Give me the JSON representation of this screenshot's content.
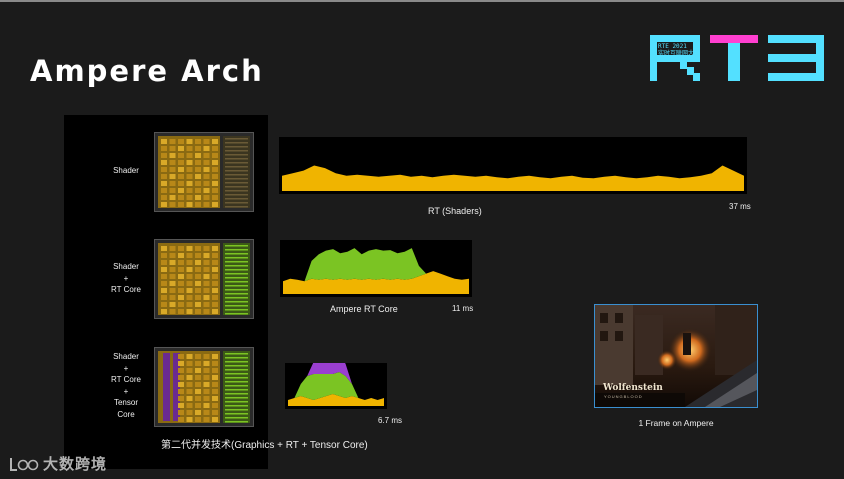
{
  "slide": {
    "title": "Ampere Arch",
    "logo": {
      "letters": "RTE",
      "tag_line1": "RTE 2021",
      "tag_line2": "实时互联网大会"
    }
  },
  "rows": [
    {
      "label_lines": [
        "Shader"
      ],
      "chart_caption": "RT (Shaders)",
      "time": "37 ms"
    },
    {
      "label_lines": [
        "Shader",
        "+",
        "RT Core"
      ],
      "chart_caption": "Ampere RT Core",
      "time": "11 ms"
    },
    {
      "label_lines": [
        "Shader",
        "+",
        "RT Core",
        "+",
        "Tensor",
        "Core"
      ],
      "chart_caption": "",
      "time": "6.7 ms"
    }
  ],
  "bottom_caption": "第二代并发技术(Graphics + RT + Tensor Core)",
  "frame": {
    "caption": "1 Frame on Ampere",
    "game_logo": "Wolfenstein",
    "game_sub": "YOUNGBLOOD"
  },
  "watermark": {
    "text": "大数跨境"
  },
  "colors": {
    "shader": "#f0b400",
    "rt_core": "#7bc423",
    "tensor": "#9a3fd0",
    "logo": "#53e0ff",
    "logo_accent": "#ff3fd0",
    "frame_border": "#3a8fd0"
  },
  "chart_data": [
    {
      "type": "area",
      "title": "RT (Shaders)",
      "time_ms": 37,
      "series": [
        {
          "name": "Shader",
          "values": [
            0.3,
            0.35,
            0.4,
            0.5,
            0.45,
            0.35,
            0.3,
            0.32,
            0.3,
            0.28,
            0.3,
            0.32,
            0.28,
            0.3,
            0.27,
            0.3,
            0.32,
            0.3,
            0.28,
            0.3,
            0.27,
            0.25,
            0.28,
            0.3,
            0.27,
            0.25,
            0.28,
            0.3,
            0.26,
            0.25,
            0.28,
            0.3,
            0.27,
            0.25,
            0.27,
            0.3,
            0.28,
            0.25,
            0.27,
            0.3,
            0.35,
            0.5,
            0.4,
            0.3
          ]
        }
      ]
    },
    {
      "type": "area",
      "title": "Ampere RT Core",
      "time_ms": 11,
      "series": [
        {
          "name": "Shader",
          "values": [
            0.25,
            0.3,
            0.28,
            0.25,
            0.3,
            0.28,
            0.3,
            0.28,
            0.3,
            0.28,
            0.3,
            0.28,
            0.3,
            0.28,
            0.3,
            0.28,
            0.3,
            0.28,
            0.3,
            0.35,
            0.4,
            0.45,
            0.4,
            0.35,
            0.3,
            0.28,
            0.3
          ]
        },
        {
          "name": "RT Core",
          "values": [
            0,
            0,
            0,
            0,
            0.35,
            0.5,
            0.55,
            0.6,
            0.5,
            0.55,
            0.6,
            0.5,
            0.55,
            0.6,
            0.55,
            0.58,
            0.5,
            0.55,
            0.6,
            0.2,
            0,
            0,
            0,
            0,
            0,
            0,
            0
          ]
        }
      ]
    },
    {
      "type": "area",
      "title": "",
      "time_ms": 6.7,
      "series": [
        {
          "name": "Shader",
          "values": [
            0.15,
            0.2,
            0.25,
            0.2,
            0.15,
            0.2,
            0.25,
            0.3,
            0.25,
            0.2,
            0.25,
            0.2,
            0.15,
            0.2,
            0.15,
            0.2
          ]
        },
        {
          "name": "RT Core",
          "values": [
            0,
            0,
            0.3,
            0.55,
            0.65,
            0.6,
            0.55,
            0.5,
            0.6,
            0.55,
            0.3,
            0,
            0,
            0,
            0,
            0
          ]
        },
        {
          "name": "Tensor",
          "values": [
            0,
            0,
            0,
            0,
            0.3,
            0.55,
            0.35,
            0.3,
            0.5,
            0.3,
            0,
            0,
            0,
            0,
            0,
            0
          ]
        }
      ]
    }
  ]
}
